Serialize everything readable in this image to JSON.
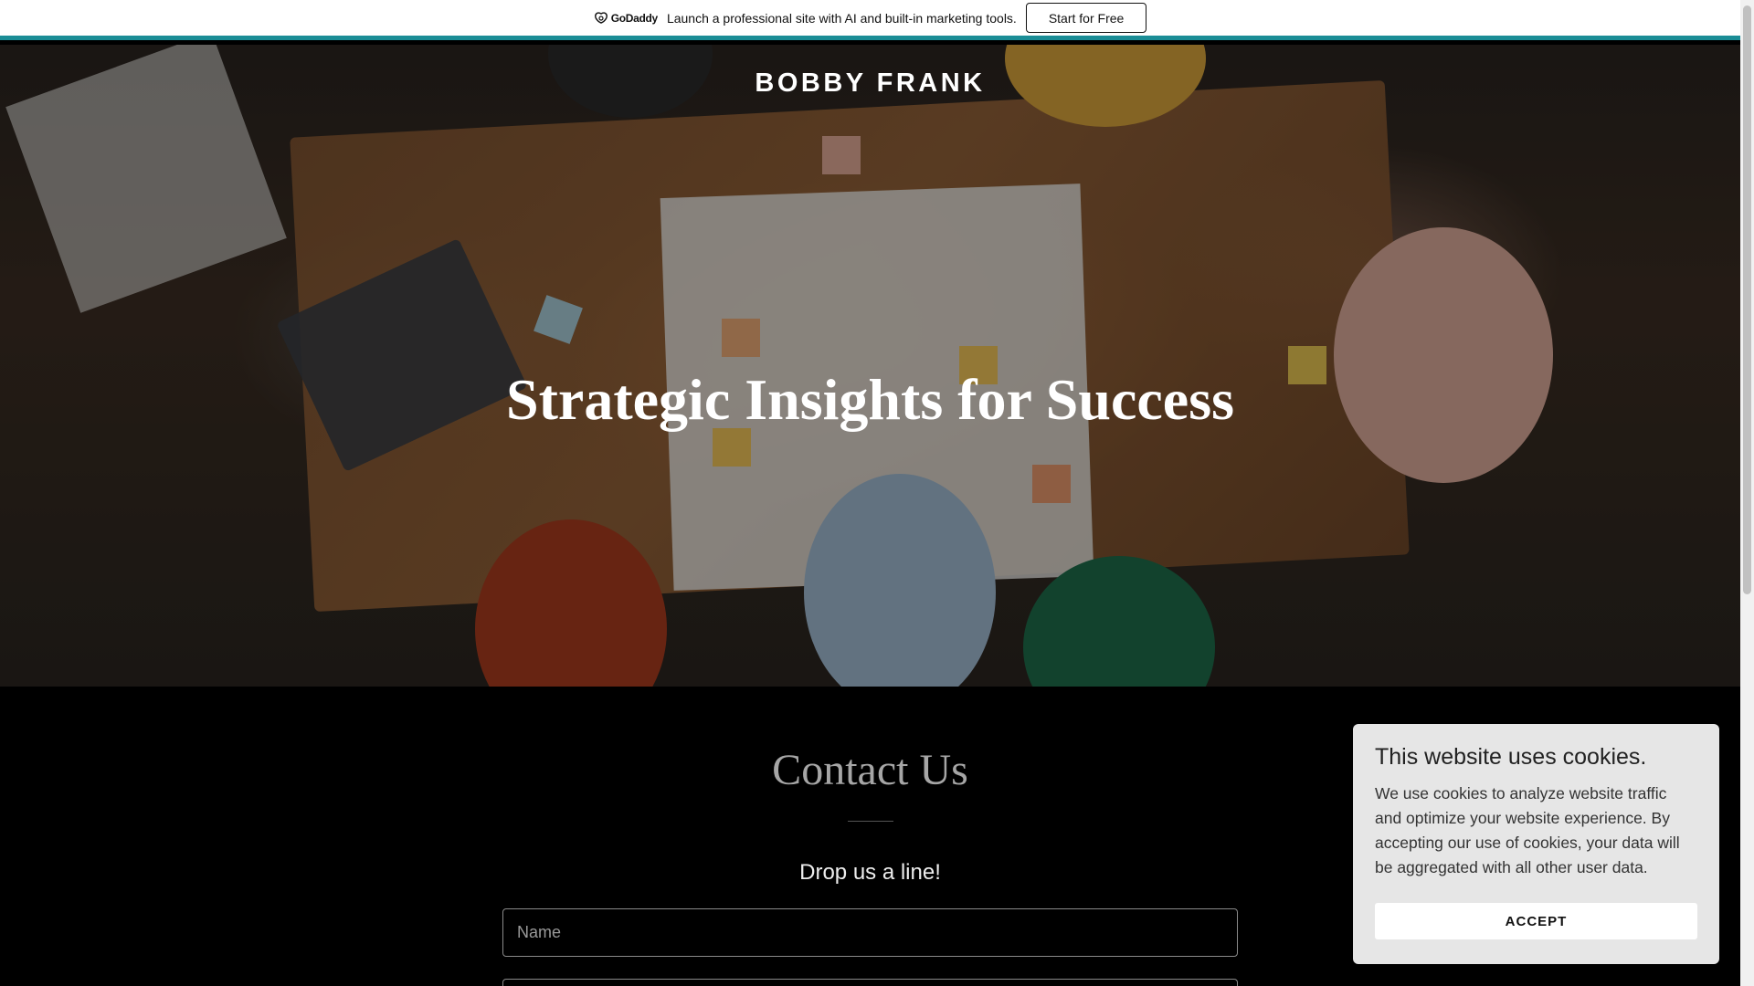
{
  "promo": {
    "logo_text": "GoDaddy",
    "message": "Launch a professional site with AI and built-in marketing tools.",
    "cta_label": "Start for Free",
    "accent_color": "#1a8d96"
  },
  "hero": {
    "brand": "BOBBY FRANK",
    "headline": "Strategic Insights for Success"
  },
  "contact": {
    "title": "Contact Us",
    "subtitle": "Drop us a line!",
    "name_placeholder": "Name"
  },
  "cookie": {
    "title": "This website uses cookies.",
    "body": "We use cookies to analyze website traffic and optimize your website experience. By accepting our use of cookies, your data will be aggregated with all other user data.",
    "accept_label": "ACCEPT"
  }
}
